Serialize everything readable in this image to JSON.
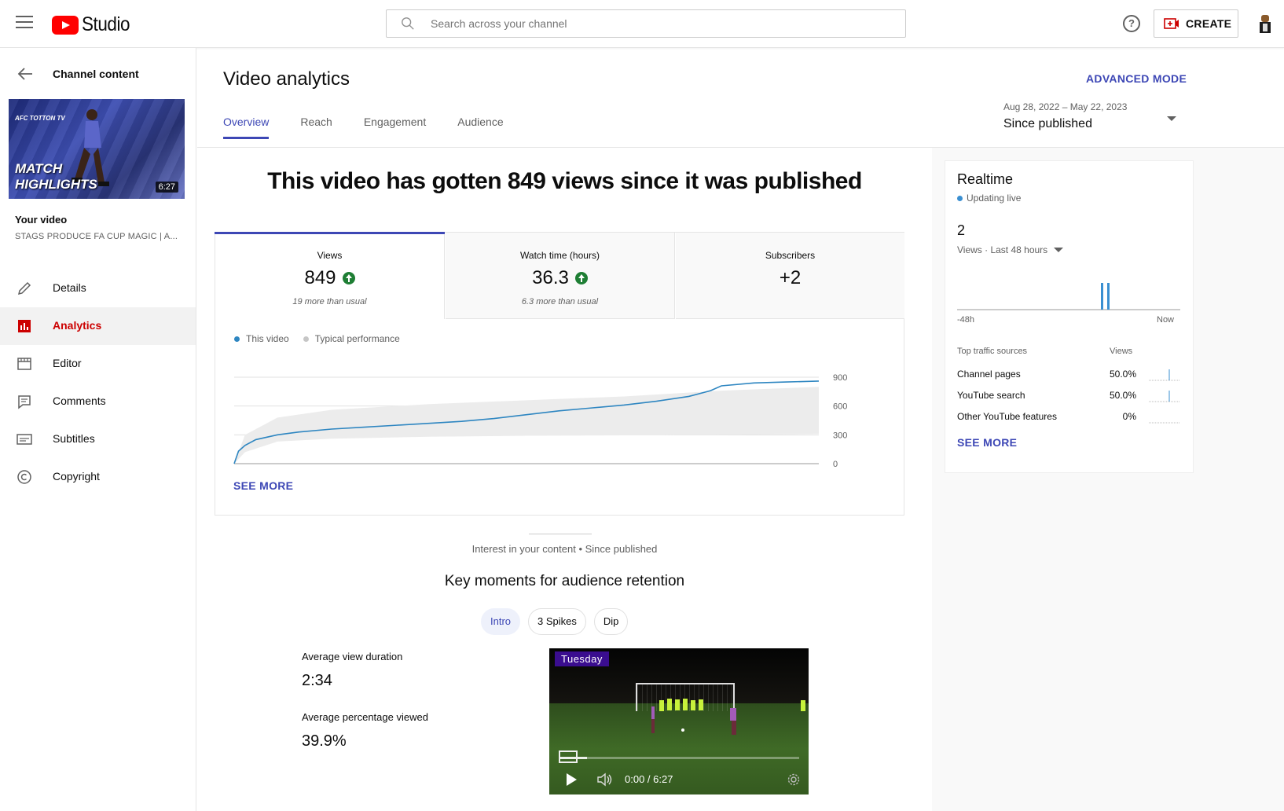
{
  "header": {
    "app_name": "Studio",
    "search_placeholder": "Search across your channel",
    "create_label": "CREATE"
  },
  "sidebar": {
    "back_label": "Channel content",
    "thumbnail": {
      "top_text": "AFC TOTTON TV",
      "line1": "MATCH",
      "line2": "HIGHLIGHTS",
      "duration": "6:27"
    },
    "your_video_label": "Your video",
    "video_title": "STAGS PRODUCE FA CUP MAGIC | A...",
    "items": [
      {
        "label": "Details",
        "icon": "pencil-icon"
      },
      {
        "label": "Analytics",
        "icon": "analytics-icon"
      },
      {
        "label": "Editor",
        "icon": "editor-icon"
      },
      {
        "label": "Comments",
        "icon": "comments-icon"
      },
      {
        "label": "Subtitles",
        "icon": "subtitles-icon"
      },
      {
        "label": "Copyright",
        "icon": "copyright-icon"
      }
    ],
    "active_item": "Analytics"
  },
  "page": {
    "title": "Video analytics",
    "advanced_mode": "ADVANCED MODE",
    "tabs": [
      "Overview",
      "Reach",
      "Engagement",
      "Audience"
    ],
    "active_tab": "Overview",
    "date_range": "Aug 28, 2022 – May 22, 2023",
    "date_label": "Since published"
  },
  "overview": {
    "headline": "This video has gotten 849 views since it was published",
    "metrics": [
      {
        "label": "Views",
        "value": "849",
        "sub": "19 more than usual",
        "trend": "up"
      },
      {
        "label": "Watch time (hours)",
        "value": "36.3",
        "sub": "6.3 more than usual",
        "trend": "up"
      },
      {
        "label": "Subscribers",
        "value": "+2",
        "sub": "",
        "trend": ""
      }
    ],
    "legend": [
      "This video",
      "Typical performance"
    ],
    "see_more": "SEE MORE"
  },
  "chart_data": {
    "type": "line",
    "x": [
      0,
      2,
      5,
      10,
      20,
      30,
      45,
      60,
      75,
      90,
      105,
      120,
      135,
      150,
      165,
      180,
      195,
      210,
      220,
      225,
      240,
      255,
      270
    ],
    "series": [
      {
        "name": "This video",
        "values": [
          0,
          130,
          190,
          250,
          300,
          330,
          360,
          380,
          400,
          420,
          440,
          470,
          510,
          550,
          580,
          610,
          650,
          700,
          760,
          810,
          840,
          850,
          860
        ]
      }
    ],
    "typical_band": {
      "x": [
        0,
        5,
        20,
        45,
        90,
        135,
        180,
        225,
        270
      ],
      "low": [
        0,
        120,
        230,
        260,
        280,
        290,
        295,
        300,
        310
      ],
      "high": [
        0,
        300,
        480,
        560,
        620,
        660,
        700,
        760,
        800
      ]
    },
    "x_ticks": [
      "0",
      "45",
      "90",
      "135",
      "180",
      "225",
      "270 days"
    ],
    "y_ticks": [
      "0",
      "300",
      "600",
      "900"
    ],
    "ylim": [
      0,
      900
    ],
    "xlim": [
      0,
      270
    ]
  },
  "key_moments": {
    "interest_text": "Interest in your content • Since published",
    "title": "Key moments for audience retention",
    "chips": [
      "Intro",
      "3 Spikes",
      "Dip"
    ],
    "active_chip": "Intro",
    "avg_view_duration_label": "Average view duration",
    "avg_view_duration": "2:34",
    "avg_pct_label": "Average percentage viewed",
    "avg_pct": "39.9%",
    "video_tag": "Tuesday",
    "video_time": "0:00 / 6:27"
  },
  "realtime": {
    "title": "Realtime",
    "live_label": "Updating live",
    "count": "2",
    "subtitle": "Views · Last 48 hours",
    "axis_start": "-48h",
    "axis_end": "Now",
    "sources_header": "Top traffic sources",
    "views_header": "Views",
    "sources": [
      {
        "name": "Channel pages",
        "pct": "50.0%"
      },
      {
        "name": "YouTube search",
        "pct": "50.0%"
      },
      {
        "name": "Other YouTube features",
        "pct": "0%"
      }
    ],
    "see_more": "SEE MORE"
  },
  "colors": {
    "accent": "#3d47b5",
    "youtube_red": "#ff0000",
    "analytics_red": "#cc0000",
    "line_blue": "#2e86c1",
    "up_green": "#1e7e34"
  }
}
